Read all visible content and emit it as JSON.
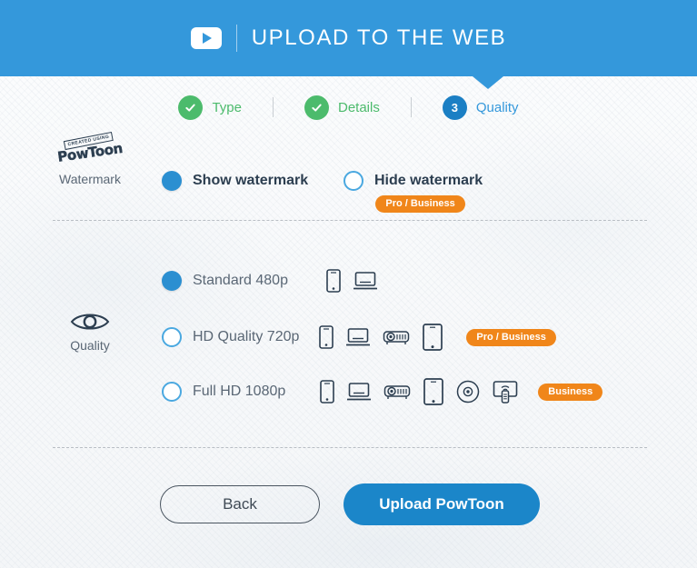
{
  "header": {
    "title": "UPLOAD TO THE WEB",
    "icon": "youtube-play-icon",
    "bg_color": "#3498db"
  },
  "steps": [
    {
      "label": "Type",
      "state": "done",
      "badge": "check"
    },
    {
      "label": "Details",
      "state": "done",
      "badge": "check"
    },
    {
      "label": "Quality",
      "state": "current",
      "badge": "3"
    }
  ],
  "sections": {
    "watermark": {
      "side_label": "Watermark",
      "logo_top_text": "CREATED USING",
      "logo_text": "PowToon",
      "options": [
        {
          "label": "Show watermark",
          "selected": true,
          "badge": null
        },
        {
          "label": "Hide watermark",
          "selected": false,
          "badge": "Pro / Business"
        }
      ]
    },
    "quality": {
      "side_label": "Quality",
      "side_icon": "eye-icon",
      "options": [
        {
          "label": "Standard 480p",
          "selected": true,
          "badge": null,
          "devices": [
            "phone-icon",
            "laptop-icon"
          ]
        },
        {
          "label": "HD Quality 720p",
          "selected": false,
          "badge": "Pro / Business",
          "devices": [
            "phone-icon",
            "laptop-icon",
            "projector-icon",
            "tablet-icon"
          ]
        },
        {
          "label": "Full HD 1080p",
          "selected": false,
          "badge": "Business",
          "devices": [
            "phone-icon",
            "laptop-icon",
            "projector-icon",
            "tablet-icon",
            "disc-icon",
            "tv-remote-icon"
          ]
        }
      ]
    }
  },
  "footer": {
    "back_label": "Back",
    "upload_label": "Upload PowToon"
  },
  "colors": {
    "brand_blue": "#3498db",
    "button_blue": "#1b86c9",
    "done_green": "#4cbb6c",
    "badge_orange": "#f0861a",
    "text_dark": "#2c3e50",
    "text_muted": "#5a6775"
  }
}
